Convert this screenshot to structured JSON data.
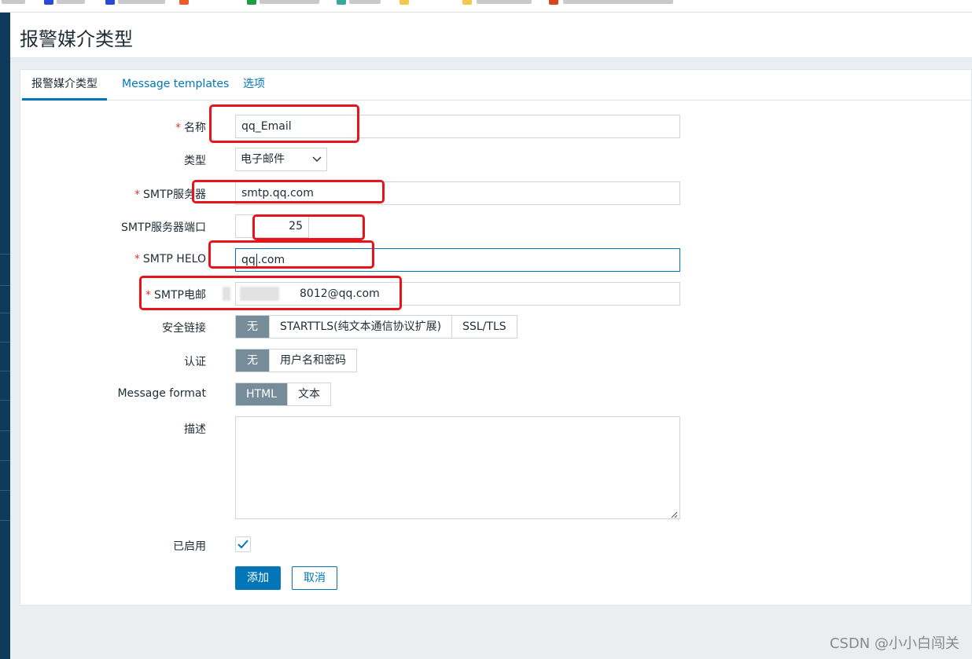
{
  "page": {
    "title": "报警媒介类型"
  },
  "tabs": [
    {
      "label": "报警媒介类型",
      "active": true
    },
    {
      "label": "Message templates",
      "active": false
    },
    {
      "label": "选项",
      "active": false
    }
  ],
  "form": {
    "name": {
      "label": "名称",
      "value": "qq_Email",
      "required": true
    },
    "type": {
      "label": "类型",
      "value": "电子邮件"
    },
    "smtp_server": {
      "label": "SMTP服务器",
      "value": "smtp.qq.com",
      "required": true
    },
    "smtp_port": {
      "label": "SMTP服务器端口",
      "value": "25"
    },
    "smtp_helo": {
      "label": "SMTP HELO",
      "value_before": "qq",
      "value_after": ".com",
      "required": true
    },
    "smtp_email": {
      "label": "SMTP电邮",
      "value": "8012@qq.com",
      "required": true
    },
    "security": {
      "label": "安全链接",
      "options": [
        "无",
        "STARTTLS(纯文本通信协议扩展)",
        "SSL/TLS"
      ],
      "selected": "无"
    },
    "auth": {
      "label": "认证",
      "options": [
        "无",
        "用户名和密码"
      ],
      "selected": "无"
    },
    "message_format": {
      "label": "Message format",
      "options": [
        "HTML",
        "文本"
      ],
      "selected": "HTML"
    },
    "description": {
      "label": "描述",
      "value": ""
    },
    "enabled": {
      "label": "已启用",
      "checked": true
    }
  },
  "buttons": {
    "add": "添加",
    "cancel": "取消"
  },
  "watermark": "CSDN @小小白闯关",
  "colors": {
    "accent": "#0275b8",
    "sidebar": "#0e3a5c",
    "selected_segment": "#768d99",
    "annotation": "#e8141c",
    "required": "#e33734"
  },
  "icons": {
    "select_arrow": "chevron-down-icon",
    "checkbox": "check-icon",
    "textarea_grip": "resize-grip-icon"
  }
}
